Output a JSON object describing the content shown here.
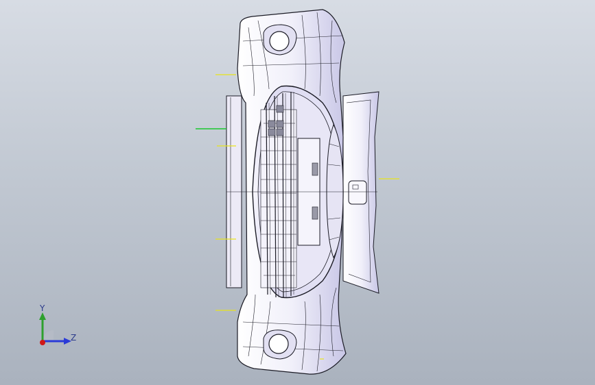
{
  "viewport": {
    "background_top": "#d7dce4",
    "background_bottom": "#aab2be"
  },
  "model": {
    "part": "front-bumper-with-grille",
    "face_color": "#f1f0fa",
    "edge_color": "#1a1a24",
    "highlight_color": "#c8c6e6",
    "dimension_line_color": "#e8e41a",
    "selected_edge_color": "#18c82e"
  },
  "triad": {
    "y_label": "Y",
    "z_label": "Z",
    "y_color": "#2ea02e",
    "z_color": "#2a3ad8",
    "x_color": "#d01818"
  }
}
